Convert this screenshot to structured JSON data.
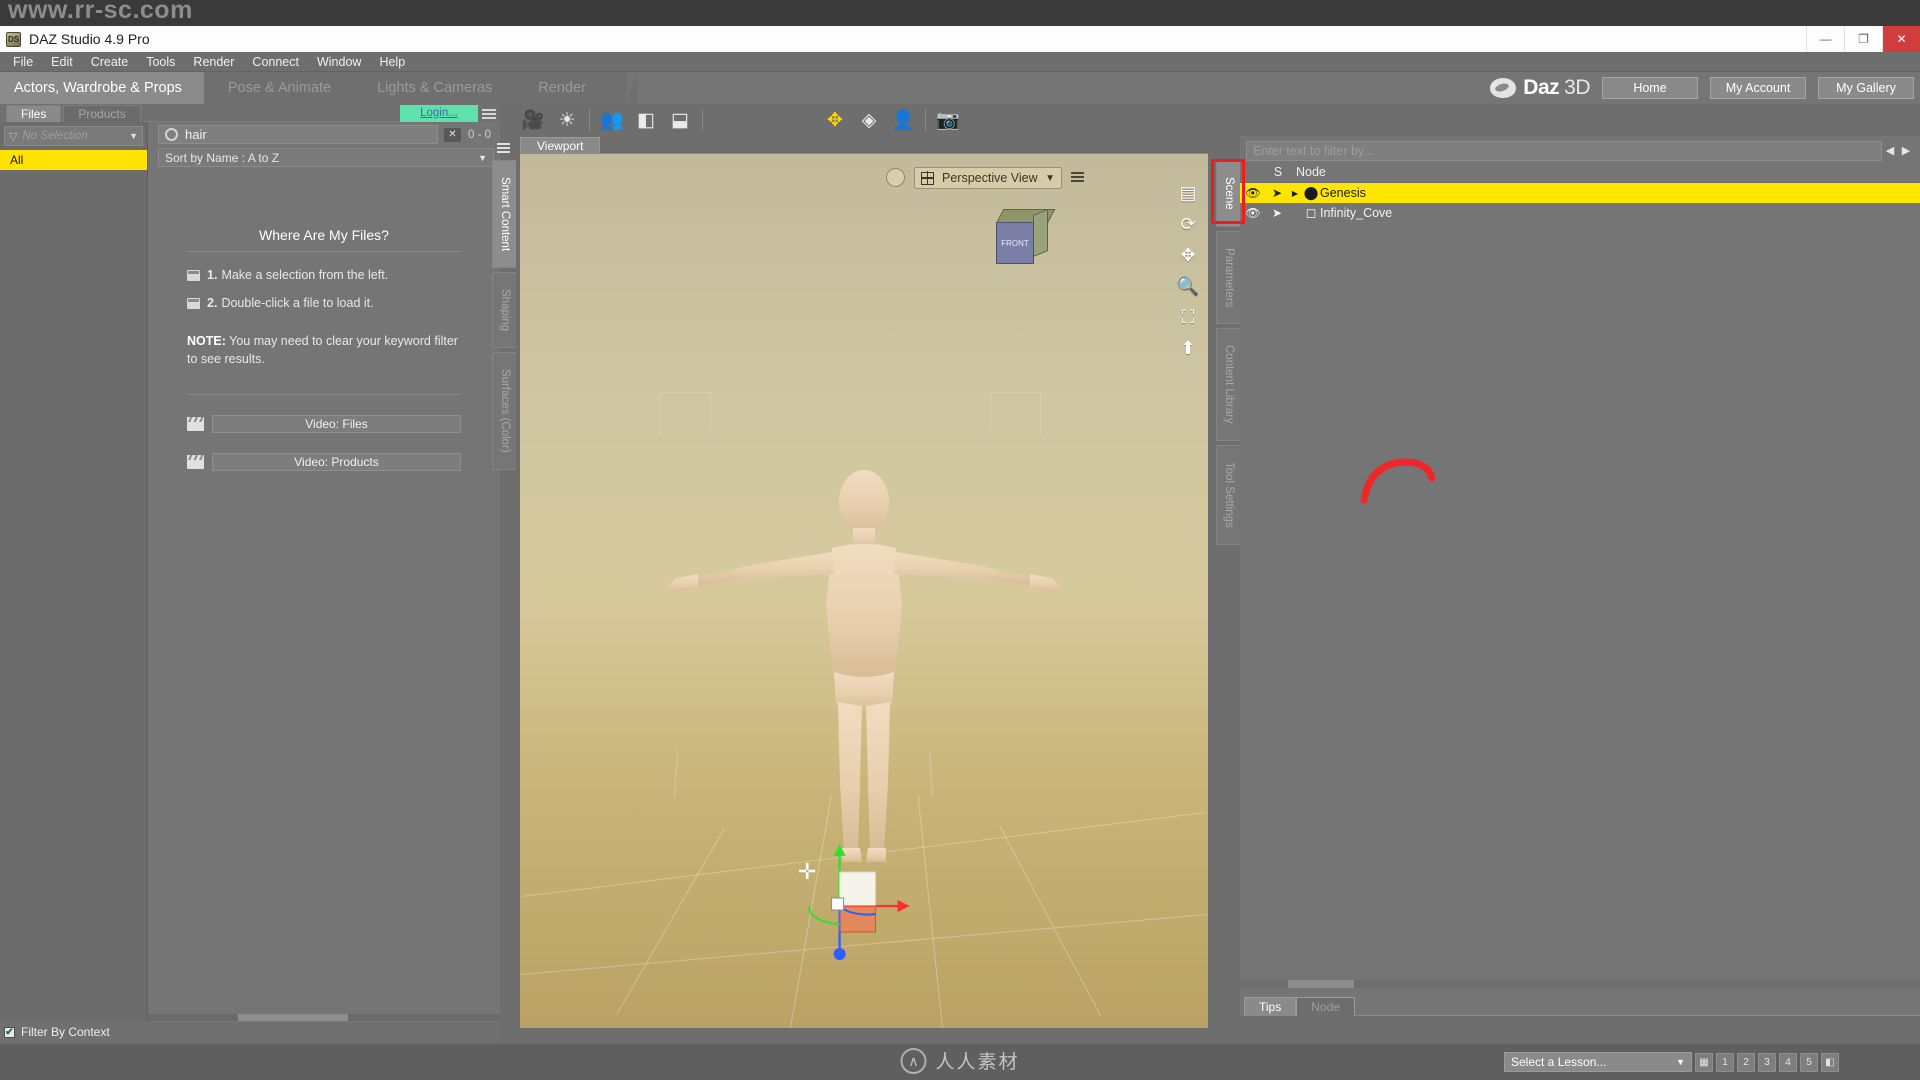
{
  "watermark": {
    "url": "www.rr-sc.com",
    "center_text": "人人素材",
    "logo_glyph": "∧"
  },
  "titlebar": {
    "app_icon_label": "DS",
    "title": "DAZ Studio 4.9 Pro",
    "minimize": "—",
    "maximize": "❐",
    "close": "✕"
  },
  "menubar": {
    "items": [
      {
        "label": "File",
        "accel": "F"
      },
      {
        "label": "Edit",
        "accel": "E"
      },
      {
        "label": "Create",
        "accel": "C"
      },
      {
        "label": "Tools",
        "accel": "T"
      },
      {
        "label": "Render",
        "accel": "R"
      },
      {
        "label": "Connect",
        "accel": "o"
      },
      {
        "label": "Window",
        "accel": "W"
      },
      {
        "label": "Help",
        "accel": "H"
      }
    ]
  },
  "activity_bar": {
    "tabs": [
      {
        "label": "Actors, Wardrobe & Props",
        "active": true
      },
      {
        "label": "Pose & Animate",
        "active": false
      },
      {
        "label": "Lights & Cameras",
        "active": false
      },
      {
        "label": "Render",
        "active": false
      }
    ],
    "brand": {
      "name": "Daz",
      "suffix": "3D"
    },
    "account_buttons": [
      "Home",
      "My Account",
      "My Gallery"
    ]
  },
  "toolbar": {
    "icons": [
      {
        "name": "add-camera-icon",
        "glyph": "🎥"
      },
      {
        "name": "add-light-icon",
        "glyph": "☀"
      },
      {
        "name": "figure-group-icon",
        "glyph": "👥"
      },
      {
        "name": "save-scene-subset-icon",
        "glyph": "◧"
      },
      {
        "name": "save-support-asset-icon",
        "glyph": "⬓"
      },
      {
        "name": "universal-tool-icon",
        "glyph": "✥",
        "highlight": true
      },
      {
        "name": "surface-selection-icon",
        "glyph": "◈"
      },
      {
        "name": "node-selection-icon",
        "glyph": "👤"
      },
      {
        "name": "render-camera-icon",
        "glyph": "📷"
      }
    ]
  },
  "left_pane": {
    "tabs": [
      {
        "label": "Files",
        "active": true
      },
      {
        "label": "Products",
        "active": false
      }
    ],
    "login_label": "Login...",
    "selection_filter": {
      "value": "No Selection",
      "caret": "▼"
    },
    "category_rows": [
      {
        "label": "All",
        "selected": true
      }
    ],
    "search": {
      "value": "hair",
      "placeholder": "",
      "clear_label": "✕",
      "count": "0 - 0"
    },
    "sort": {
      "label": "Sort by Name : A to Z",
      "caret": "▼"
    },
    "empty_state": {
      "title": "Where Are My Files?",
      "steps": [
        {
          "num": "1.",
          "text": "Make a selection from the left."
        },
        {
          "num": "2.",
          "text": "Double-click a file to load it."
        }
      ],
      "note_label": "NOTE:",
      "note_text": "You may need to clear your keyword filter to see results."
    },
    "video_buttons": [
      {
        "label": "Video: Files"
      },
      {
        "label": "Video:  Products"
      }
    ],
    "filter_by_context": {
      "label": "Filter By Context",
      "checked": true,
      "check_glyph": "✔"
    }
  },
  "left_vtabs": [
    {
      "label": "Smart Content",
      "active": true
    },
    {
      "label": "Shaping",
      "active": false
    },
    {
      "label": "Surfaces (Color)",
      "active": false
    }
  ],
  "right_vtabs": [
    {
      "label": "Scene",
      "active": true
    },
    {
      "label": "Parameters",
      "active": false
    },
    {
      "label": "Content Library",
      "active": false
    },
    {
      "label": "Tool Settings",
      "active": false
    }
  ],
  "viewport": {
    "tab_label": "Viewport",
    "view_selector": {
      "label": "Perspective View",
      "caret": "▼"
    },
    "viewcube": {
      "front_label": "FRONT"
    },
    "nav_icons": [
      {
        "name": "viewport-menu-icon",
        "glyph": "▤"
      },
      {
        "name": "orbit-icon",
        "glyph": "⟳"
      },
      {
        "name": "pan-icon",
        "glyph": "✥"
      },
      {
        "name": "zoom-icon",
        "glyph": "🔍"
      },
      {
        "name": "frame-icon",
        "glyph": "⛶"
      },
      {
        "name": "reset-view-icon",
        "glyph": "⬆"
      }
    ]
  },
  "right_pane": {
    "filter_placeholder": "Enter text to filter by...",
    "nav_prev": "◀",
    "nav_next": "▶",
    "columns": [
      {
        "name": "visibility",
        "label": ""
      },
      {
        "name": "selectable",
        "label": "S"
      },
      {
        "name": "node",
        "label": "Node"
      }
    ],
    "rows": [
      {
        "label": "Genesis",
        "selected": true,
        "expandable": true,
        "expander": "▶",
        "eye": "👁",
        "select_glyph": "➤",
        "node_icon": "⬤"
      },
      {
        "label": "Infinity_Cove",
        "selected": false,
        "expandable": false,
        "expander": "",
        "eye": "👁",
        "select_glyph": "➤",
        "node_icon": "◻"
      }
    ],
    "bottom_tabs": [
      {
        "label": "Tips",
        "active": true
      },
      {
        "label": "Node",
        "active": false
      }
    ]
  },
  "status_bar": {
    "lesson_select": {
      "label": "Select a Lesson...",
      "caret": "▼"
    },
    "mini_buttons": [
      "▦",
      "1",
      "2",
      "3",
      "4",
      "5",
      "◧"
    ]
  }
}
